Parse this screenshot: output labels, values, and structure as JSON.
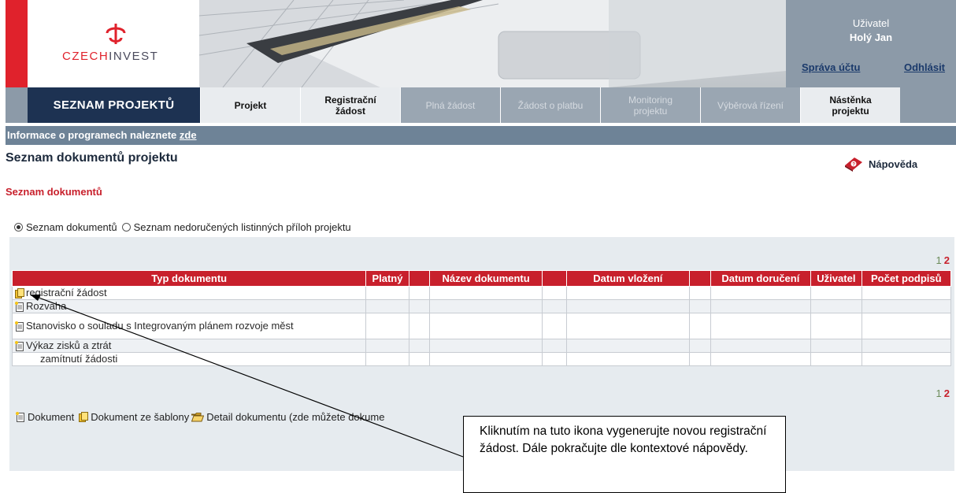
{
  "brand": {
    "logo_prefix": "CZECH",
    "logo_suffix": "INVEST",
    "accent_red": "#e0222c",
    "nav_dark": "#1d3252",
    "nav_grey": "#8c9aa8"
  },
  "user": {
    "label": "Uživatel",
    "name": "Holý Jan",
    "account_link": "Správa účtu",
    "logout_link": "Odhlásit"
  },
  "nav": {
    "main": "SEZNAM PROJEKTŮ",
    "tabs": [
      {
        "label": "Projekt",
        "enabled": true
      },
      {
        "label": "Registrační žádost",
        "enabled": true
      },
      {
        "label": "Plná žádost",
        "enabled": false
      },
      {
        "label": "Žádost o platbu",
        "enabled": false
      },
      {
        "label": "Monitoring projektu",
        "enabled": false
      },
      {
        "label": "Výběrová řízení",
        "enabled": false
      },
      {
        "label": "Nástěnka projektu",
        "enabled": true
      }
    ]
  },
  "info": {
    "text": "Informace o programech naleznete ",
    "link": "zde"
  },
  "page": {
    "title": "Seznam dokumentů projektu",
    "help": "Nápověda",
    "section_title": "Seznam dokumentů"
  },
  "filters": {
    "option1": "Seznam dokumentů",
    "option2": "Seznam nedoručených listinných příloh projektu",
    "selected": 1
  },
  "pager": {
    "page1": "1",
    "page2": "2"
  },
  "table": {
    "headers": [
      "Typ dokumentu",
      "Platný",
      "",
      "Název dokumentu",
      "",
      "Datum vložení",
      "",
      "Datum doručení",
      "Uživatel",
      "Počet podpisů"
    ],
    "rows": [
      {
        "type": "registrační žádost",
        "icon": "template-document-icon"
      },
      {
        "type": "Rozvaha",
        "icon": "new-document-icon"
      },
      {
        "type": "Stanovisko o souladu s Integrovaným plánem rozvoje měst",
        "icon": "new-document-icon"
      },
      {
        "type": "Výkaz zisků a ztrát",
        "icon": "new-document-icon"
      },
      {
        "type": "zamítnutí žádosti",
        "icon": ""
      }
    ]
  },
  "legend": {
    "item1": "Dokument",
    "item2": "Dokument ze šablony",
    "item3": "Detail dokumentu (zde můžete dokume"
  },
  "callout": {
    "text": "Kliknutím na tuto ikona vygenerujte novou registrační žádost. Dále pokračujte dle kontextové nápovědy."
  }
}
